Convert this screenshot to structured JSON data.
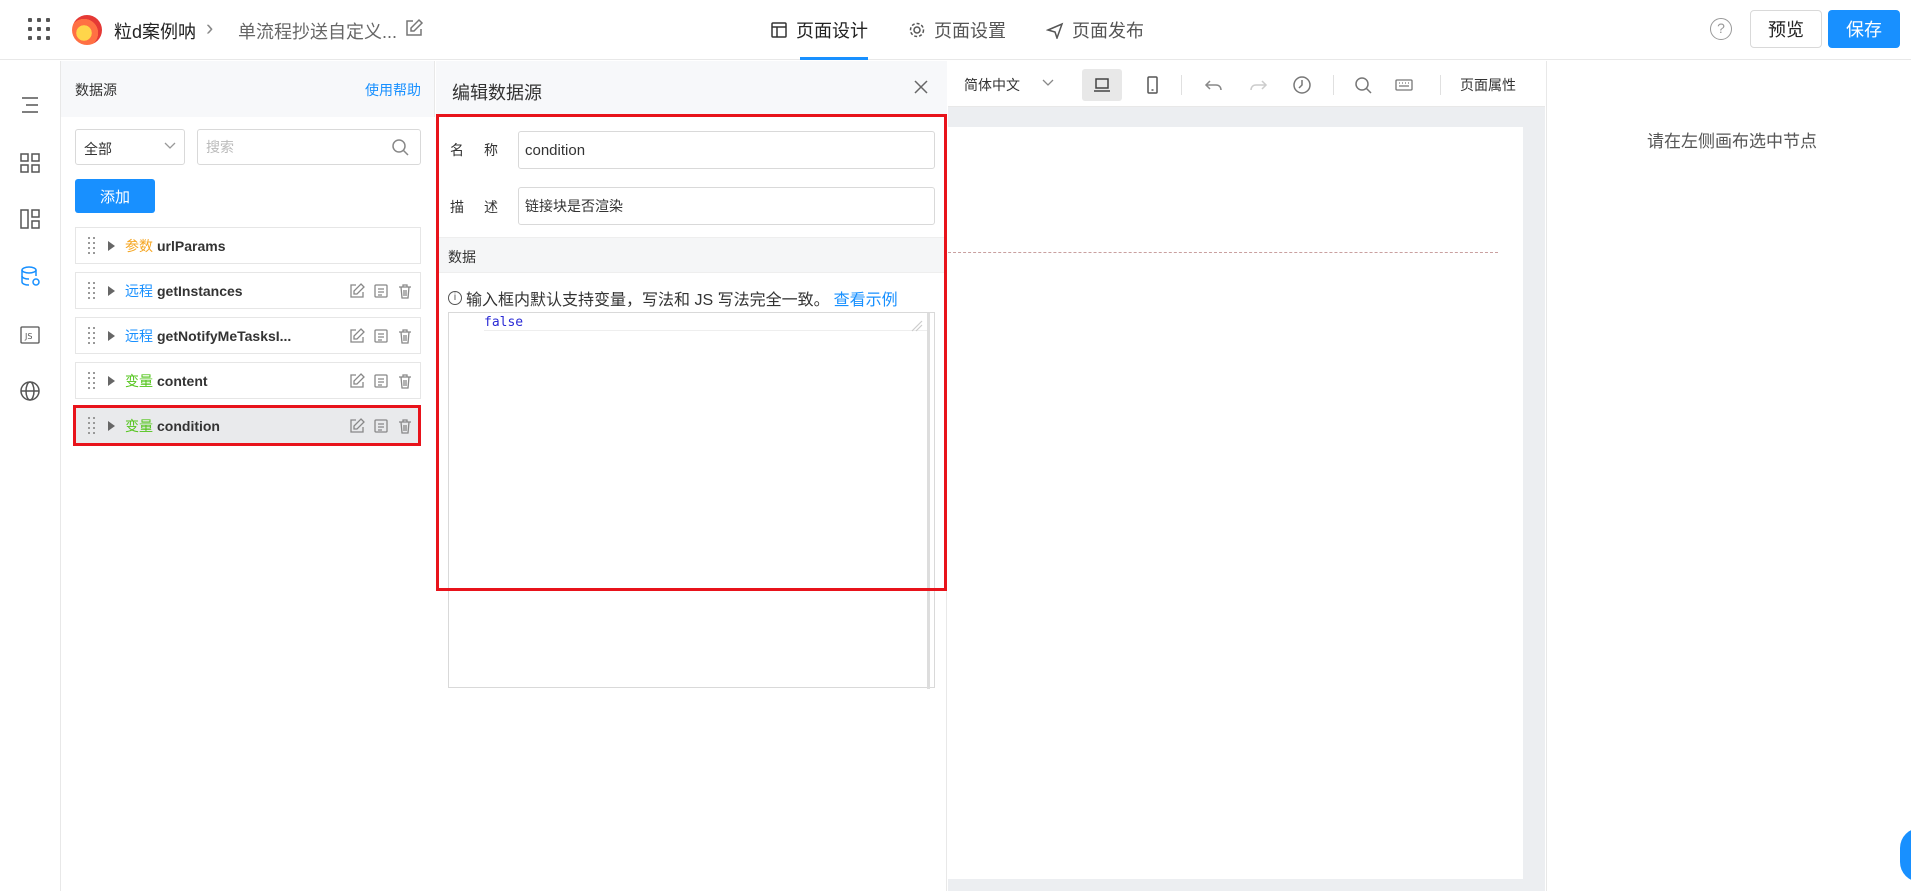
{
  "header": {
    "app_name": "粒d案例呐",
    "page_name": "单流程抄送自定义...",
    "tabs": [
      {
        "label": "页面设计",
        "icon": "layout-icon",
        "active": true
      },
      {
        "label": "页面设置",
        "icon": "gear-icon",
        "active": false
      },
      {
        "label": "页面发布",
        "icon": "send-icon",
        "active": false
      }
    ],
    "help_glyph": "?",
    "preview_label": "预览",
    "save_label": "保存"
  },
  "datasource": {
    "title": "数据源",
    "help_link": "使用帮助",
    "filter_value": "全部",
    "search_placeholder": "搜索",
    "add_label": "添加",
    "items": [
      {
        "type": "参数",
        "type_color": "#f5a623",
        "name": "urlParams",
        "has_actions": false
      },
      {
        "type": "远程",
        "type_color": "#1890ff",
        "name": "getInstances",
        "has_actions": true
      },
      {
        "type": "远程",
        "type_color": "#1890ff",
        "name": "getNotifyMeTasksI...",
        "has_actions": true
      },
      {
        "type": "变量",
        "type_color": "#52c41a",
        "name": "content",
        "has_actions": true
      },
      {
        "type": "变量",
        "type_color": "#52c41a",
        "name": "condition",
        "has_actions": true,
        "selected": true
      }
    ]
  },
  "editor": {
    "title": "编辑数据源",
    "name_label": "名称",
    "name_value": "condition",
    "desc_label": "描述",
    "desc_value": "链接块是否渲染",
    "data_label": "数据",
    "info_text": "输入框内默认支持变量，写法和 JS 写法完全一致。",
    "info_link": "查看示例",
    "info_glyph": "i",
    "code": "false"
  },
  "canvas": {
    "lang": "简体中文",
    "page_props": "页面属性"
  },
  "props_panel": {
    "hint": "请在左侧画布选中节点"
  },
  "colors": {
    "primary": "#1890ff",
    "highlight": "#e8131b"
  }
}
